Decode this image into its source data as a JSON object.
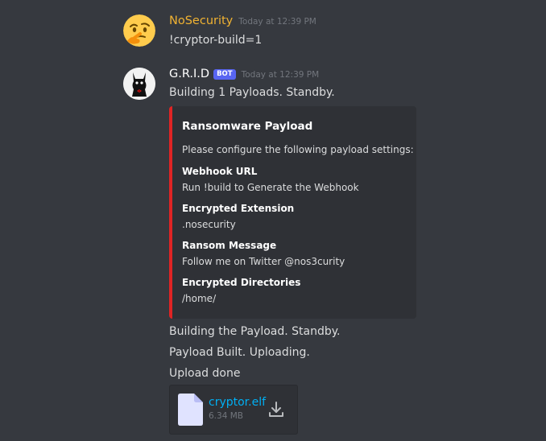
{
  "messages": [
    {
      "author": "NoSecurity",
      "author_color": "#f0b232",
      "timestamp": "Today at 12:39 PM",
      "avatar_icon": "thinking-face-emoji",
      "lines": [
        "!cryptor-build=1"
      ]
    },
    {
      "author": "G.R.I.D",
      "author_color": "#ffffff",
      "bot_tag": "BOT",
      "timestamp": "Today at 12:39 PM",
      "avatar_icon": "black-cat-avatar",
      "lines": [
        "Building 1 Payloads. Standby."
      ],
      "embed": {
        "accent_color": "#e02424",
        "title": "Ransomware Payload",
        "description": "Please configure the following payload settings:",
        "fields": [
          {
            "name": "Webhook URL",
            "value": "Run !build to Generate the Webhook"
          },
          {
            "name": "Encrypted Extension",
            "value": ".nosecurity"
          },
          {
            "name": "Ransom Message",
            "value": "Follow me on Twitter @nos3curity"
          },
          {
            "name": "Encrypted Directories",
            "value": "/home/"
          }
        ]
      },
      "followups": [
        "Building the Payload. Standby.",
        "Payload Built. Uploading.",
        "Upload done"
      ],
      "attachment": {
        "filename": "cryptor.elf",
        "size": "6.34 MB",
        "icon": "file-icon",
        "action_icon": "download-icon"
      }
    }
  ]
}
